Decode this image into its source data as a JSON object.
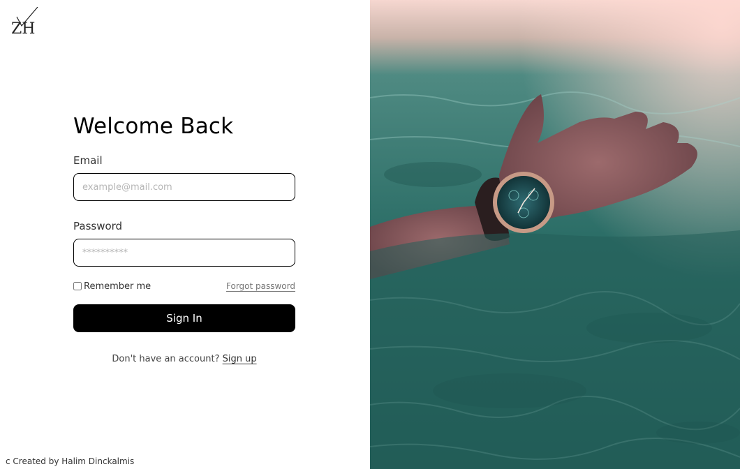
{
  "logo": {
    "text": "ZH"
  },
  "form": {
    "title": "Welcome Back",
    "email_label": "Email",
    "email_placeholder": "example@mail.com",
    "password_label": "Password",
    "password_placeholder": "**********",
    "remember_label": "Remember me",
    "forgot_label": "Forgot password",
    "signin_label": "Sign In",
    "signup_prompt": "Don't have an account? ",
    "signup_label": "Sign up"
  },
  "footer": {
    "text": "c Created by Halim Dinckalmis"
  },
  "hero": {
    "icon": "hand-with-watch-in-water-photo"
  },
  "colors": {
    "accent": "#000000",
    "water": "#2f7a72",
    "sky": "#f2c9c4"
  }
}
